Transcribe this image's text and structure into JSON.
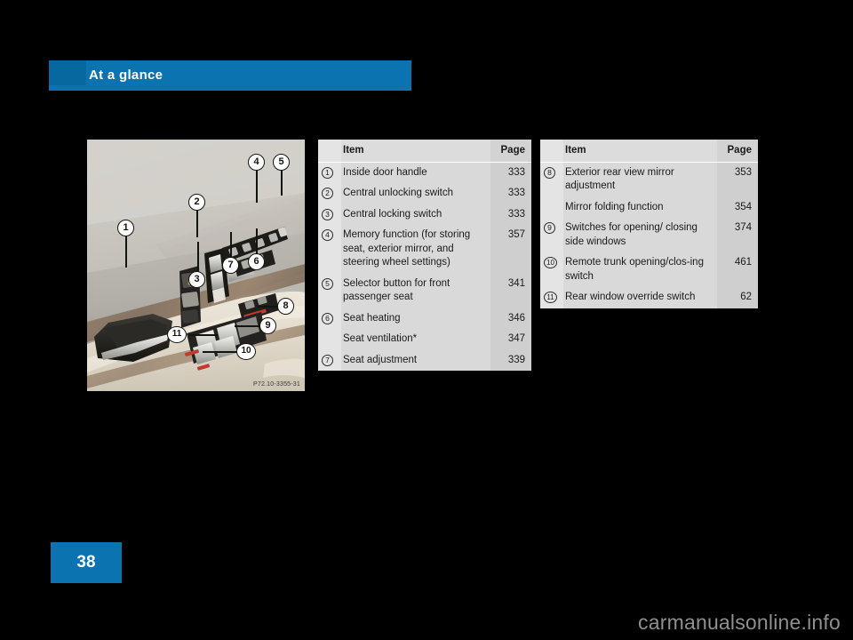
{
  "header": {
    "title": "At a glance",
    "accent_color": "#0B74B0",
    "tab_color": "#0768A0"
  },
  "figure": {
    "reference": "P72.10-3355-31",
    "description": "Driver door control panel with inside door handle, locking switches, memory buttons, seat controls and window switches",
    "callouts": [
      "1",
      "2",
      "3",
      "4",
      "5",
      "6",
      "7",
      "8",
      "9",
      "10",
      "11"
    ]
  },
  "tables": [
    {
      "id": "table-1",
      "headers": {
        "item": "Item",
        "page": "Page"
      },
      "rows": [
        {
          "num": "1",
          "item": "Inside door handle",
          "page": "333"
        },
        {
          "num": "2",
          "item": "Central unlocking switch",
          "page": "333"
        },
        {
          "num": "3",
          "item": "Central locking switch",
          "page": "333"
        },
        {
          "num": "4",
          "item": "Memory function (for storing seat, exterior mirror, and steering wheel settings)",
          "page": "357"
        },
        {
          "num": "5",
          "item": "Selector button for front passenger seat",
          "page": "341"
        },
        {
          "num": "6",
          "item": "Seat heating",
          "page": "346"
        },
        {
          "num": "",
          "item": "Seat ventilation*",
          "page": "347"
        },
        {
          "num": "7",
          "item": "Seat adjustment",
          "page": "339"
        }
      ]
    },
    {
      "id": "table-2",
      "headers": {
        "item": "Item",
        "page": "Page"
      },
      "rows": [
        {
          "num": "8",
          "item": "Exterior rear view mirror adjustment",
          "page": "353"
        },
        {
          "num": "",
          "item": "Mirror folding function",
          "page": "354"
        },
        {
          "num": "9",
          "item": "Switches for opening/ closing side windows",
          "page": "374"
        },
        {
          "num": "10",
          "item": "Remote trunk opening/clos-ing switch",
          "page": "461"
        },
        {
          "num": "11",
          "item": "Rear window override switch",
          "page": "62"
        }
      ]
    }
  ],
  "page_number": "38",
  "watermark": "carmanualsonline.info"
}
